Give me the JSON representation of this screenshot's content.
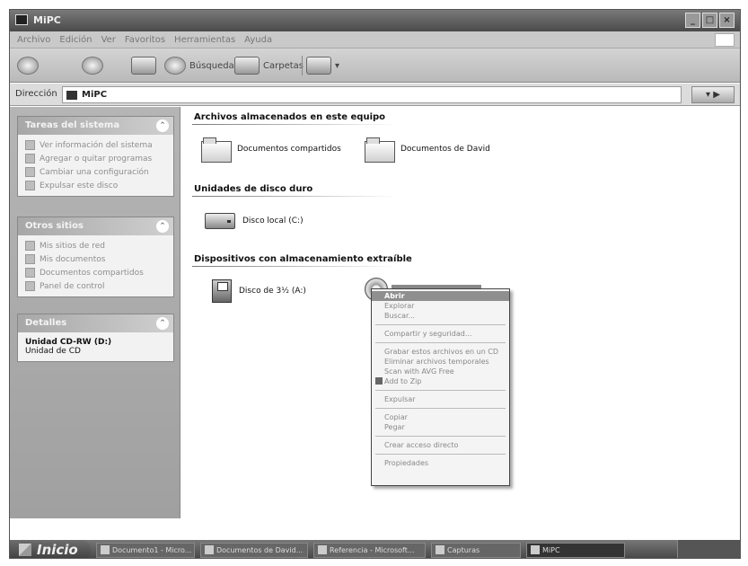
{
  "window": {
    "title": "MiPC"
  },
  "menu": [
    "Archivo",
    "Edición",
    "Ver",
    "Favoritos",
    "Herramientas",
    "Ayuda"
  ],
  "toolbar": {
    "search": "Búsqueda",
    "folders": "Carpetas"
  },
  "address": {
    "label": "Dirección",
    "value": "MiPC"
  },
  "sidebar": {
    "system_tasks": {
      "title": "Tareas del sistema",
      "items": [
        "Ver información del sistema",
        "Agregar o quitar programas",
        "Cambiar una configuración",
        "Expulsar este disco"
      ]
    },
    "other_places": {
      "title": "Otros sitios",
      "items": [
        "Mis sitios de red",
        "Mis documentos",
        "Documentos compartidos",
        "Panel de control"
      ]
    },
    "details": {
      "title": "Detalles",
      "name": "Unidad CD-RW (D:)",
      "type": "Unidad de CD"
    }
  },
  "content": {
    "stored_files": {
      "title": "Archivos almacenados en este equipo",
      "items": [
        "Documentos compartidos",
        "Documentos de David"
      ]
    },
    "hard_disks": {
      "title": "Unidades de disco duro",
      "items": [
        "Disco local (C:)"
      ]
    },
    "removable": {
      "title": "Dispositivos con almacenamiento extraíble",
      "items": [
        "Disco de 3½ (A:)"
      ]
    }
  },
  "context_menu": {
    "open": "Abrir",
    "explore": "Explorar",
    "search": "Buscar...",
    "sharing": "Compartir y seguridad...",
    "burn": "Grabar estos archivos en un CD",
    "delete_temp": "Eliminar archivos temporales",
    "scan": "Scan with AVG Free",
    "zip": "Add to Zip",
    "eject": "Expulsar",
    "copy": "Copiar",
    "paste": "Pegar",
    "shortcut": "Crear acceso directo",
    "properties": "Propiedades"
  },
  "taskbar": {
    "start": "Inicio",
    "tasks": [
      "Documento1 - Micro...",
      "Documentos de David...",
      "Referencia - Microsoft...",
      "Capturas",
      "MiPC"
    ]
  }
}
